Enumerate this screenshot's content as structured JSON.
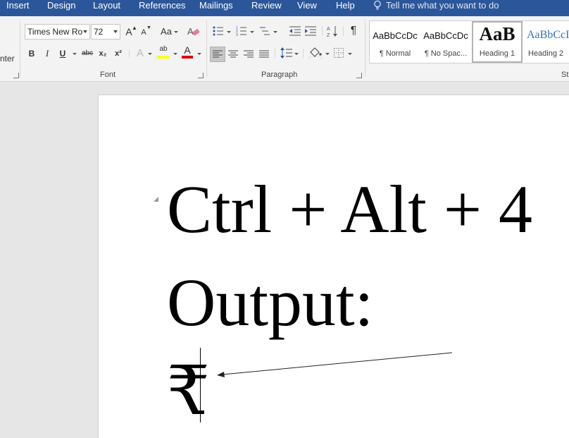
{
  "menubar": {
    "tabs": [
      "Insert",
      "Design",
      "Layout",
      "References",
      "Mailings",
      "Review",
      "View",
      "Help"
    ],
    "tell_me": "Tell me what you want to do"
  },
  "ribbon": {
    "clipboard_partial": "nter",
    "font": {
      "name": "Times New Ro",
      "size": "72",
      "group_label": "Font",
      "bold": "B",
      "italic": "I",
      "underline": "U",
      "strike": "abc",
      "subscript": "x₂",
      "superscript": "x²",
      "grow": "A",
      "shrink": "A",
      "case": "Aa",
      "text_effects": "A",
      "highlight": "ab",
      "font_color": "A"
    },
    "paragraph": {
      "group_label": "Paragraph",
      "pilcrow": "¶"
    },
    "styles": {
      "partial_label": "St",
      "items": [
        {
          "preview": "AaBbCcDc",
          "name": "¶ Normal"
        },
        {
          "preview": "AaBbCcDc",
          "name": "¶ No Spac..."
        },
        {
          "preview": "AaB",
          "name": "Heading 1"
        },
        {
          "preview": "AaBbCcI",
          "name": "Heading 2"
        }
      ]
    }
  },
  "document": {
    "line1": "Ctrl + Alt + 4",
    "line2": "Output:",
    "line3": "₹"
  },
  "colors": {
    "brand": "#2b579a",
    "highlight_yellow": "#ffff00",
    "font_red": "#e00000",
    "heading2_blue": "#2e74b5"
  }
}
